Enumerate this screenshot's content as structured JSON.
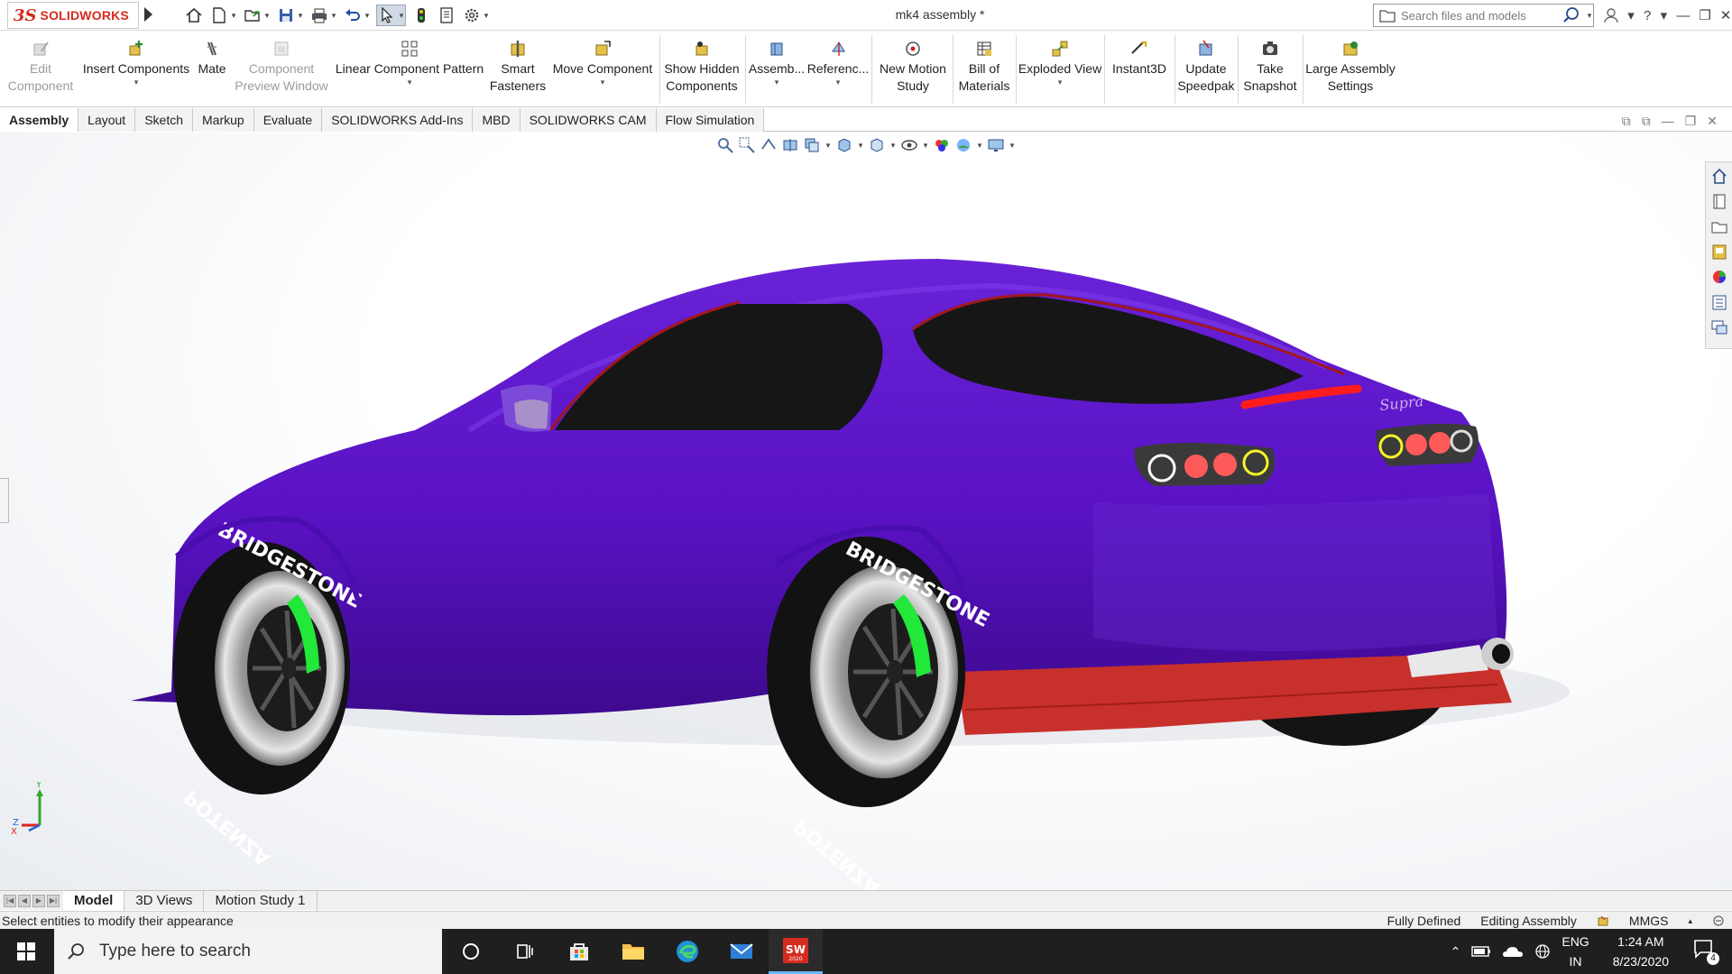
{
  "app": {
    "brand": "SOLIDWORKS",
    "document_title": "mk4 assembly *"
  },
  "search": {
    "placeholder": "Search files and models"
  },
  "command_manager": [
    {
      "label": "Edit Component",
      "line1": "Edit",
      "line2": "Component",
      "icon": "edit-component-icon",
      "enabled": false
    },
    {
      "label": "Insert Components",
      "icon": "insert-components-icon",
      "dropdown": true
    },
    {
      "label": "Mate",
      "icon": "mate-icon"
    },
    {
      "label": "Component Preview Window",
      "line1": "Component",
      "line2": "Preview Window",
      "icon": "preview-window-icon",
      "enabled": false
    },
    {
      "label": "Linear Component Pattern",
      "icon": "linear-pattern-icon",
      "dropdown": true
    },
    {
      "label": "Smart Fasteners",
      "line1": "Smart",
      "line2": "Fasteners",
      "icon": "smart-fasteners-icon"
    },
    {
      "label": "Move Component",
      "icon": "move-component-icon",
      "dropdown": true
    },
    {
      "label": "Show Hidden Components",
      "line1": "Show Hidden",
      "line2": "Components",
      "icon": "show-hidden-icon"
    },
    {
      "label": "Assemb...",
      "icon": "assembly-features-icon",
      "dropdown": true
    },
    {
      "label": "Referenc...",
      "icon": "reference-geometry-icon",
      "dropdown": true
    },
    {
      "label": "New Motion Study",
      "line1": "New Motion",
      "line2": "Study",
      "icon": "motion-study-icon"
    },
    {
      "label": "Bill of Materials",
      "line1": "Bill of",
      "line2": "Materials",
      "icon": "bom-icon"
    },
    {
      "label": "Exploded View",
      "icon": "exploded-view-icon",
      "dropdown": true
    },
    {
      "label": "Instant3D",
      "icon": "instant3d-icon"
    },
    {
      "label": "Update Speedpak",
      "line1": "Update",
      "line2": "Speedpak",
      "icon": "speedpak-icon"
    },
    {
      "label": "Take Snapshot",
      "line1": "Take",
      "line2": "Snapshot",
      "icon": "snapshot-icon"
    },
    {
      "label": "Large Assembly Settings",
      "line1": "Large Assembly",
      "line2": "Settings",
      "icon": "large-assembly-icon"
    }
  ],
  "tabs": [
    {
      "label": "Assembly",
      "active": true
    },
    {
      "label": "Layout"
    },
    {
      "label": "Sketch"
    },
    {
      "label": "Markup"
    },
    {
      "label": "Evaluate"
    },
    {
      "label": "SOLIDWORKS Add-Ins"
    },
    {
      "label": "MBD"
    },
    {
      "label": "SOLIDWORKS CAM"
    },
    {
      "label": "Flow Simulation"
    }
  ],
  "model": {
    "tire_brand": "BRIDGESTONE",
    "tire_model": "POTENZA",
    "badge": "Supra",
    "body_color": "#5a12c4",
    "diffuser_color": "#c8302c",
    "caliper_color": "#22e83a"
  },
  "triad": {
    "x": "X",
    "y": "Y",
    "z": "Z"
  },
  "bottom_tabs": [
    {
      "label": "Model",
      "active": true
    },
    {
      "label": "3D Views"
    },
    {
      "label": "Motion Study 1"
    }
  ],
  "status": {
    "hint": "Select entities to modify their appearance",
    "definition": "Fully Defined",
    "mode": "Editing Assembly",
    "units": "MMGS"
  },
  "taskbar": {
    "search_placeholder": "Type here to search",
    "lang_line1": "ENG",
    "lang_line2": "IN",
    "time": "1:24 AM",
    "date": "8/23/2020",
    "notifications": "4",
    "sw_badge": "SW",
    "sw_year": "2020"
  }
}
